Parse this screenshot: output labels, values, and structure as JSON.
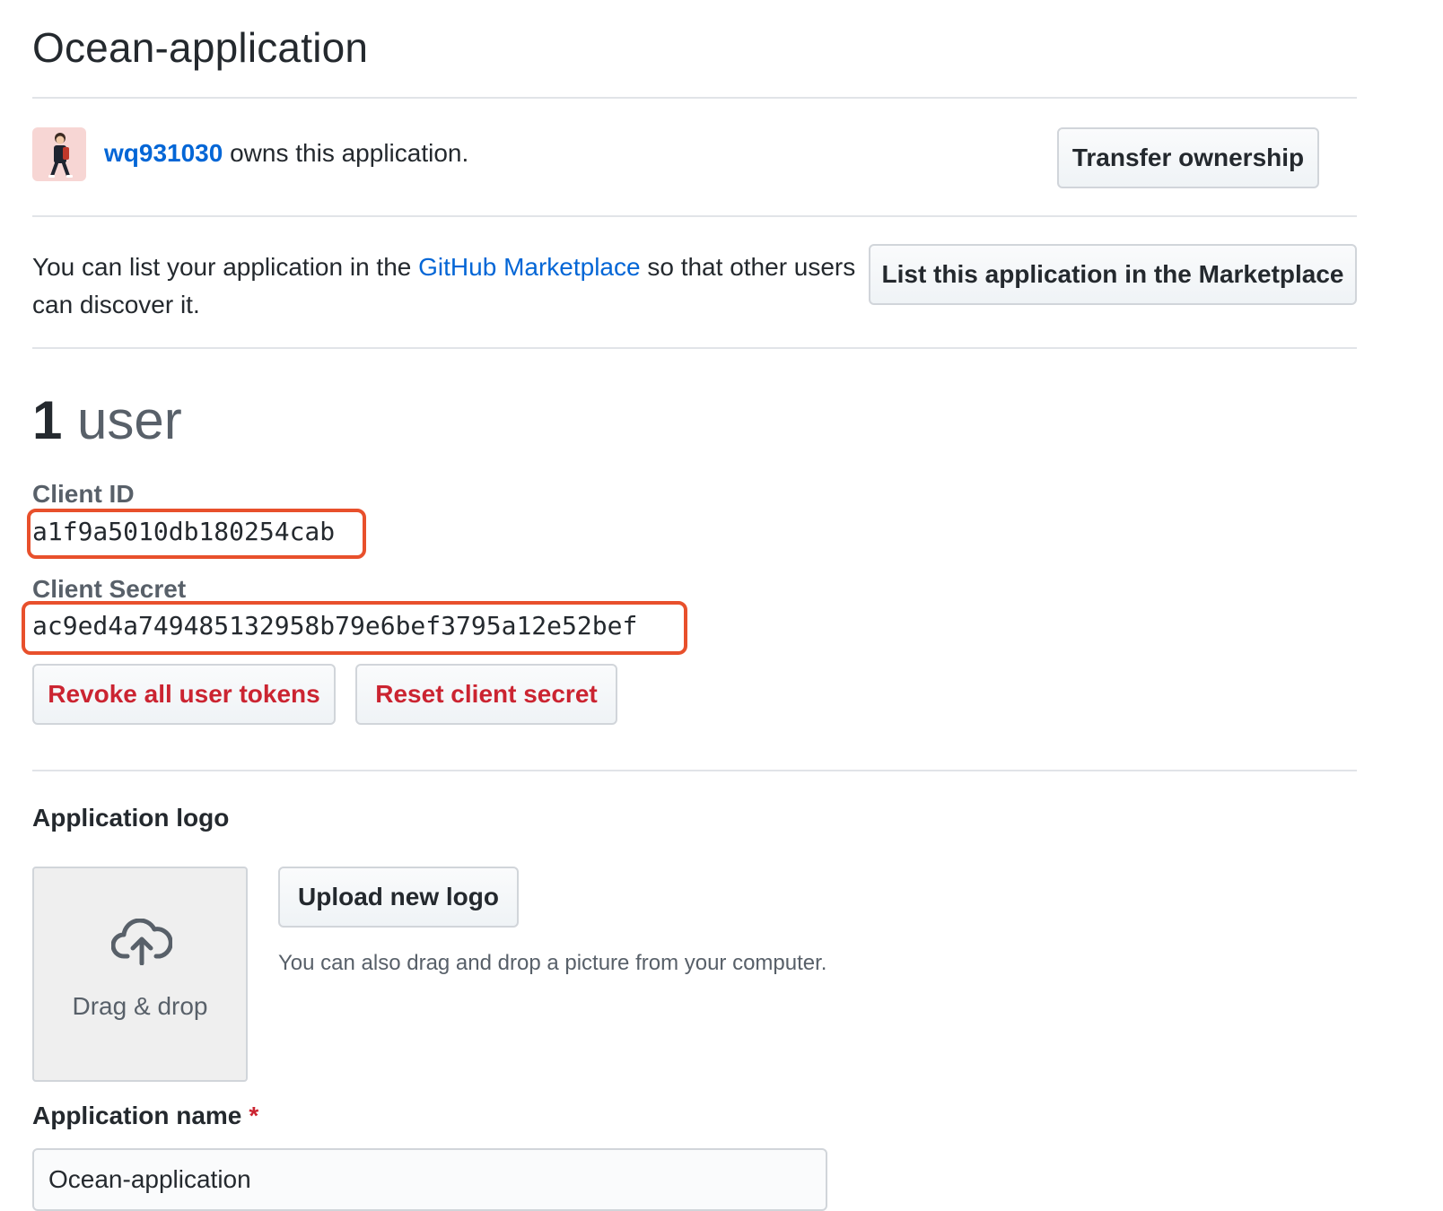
{
  "page": {
    "title": "Ocean-application"
  },
  "owner": {
    "username": "wq931030",
    "suffix": " owns this application.",
    "avatar_icon": "user-avatar-icon",
    "transfer_label": "Transfer ownership"
  },
  "marketplace": {
    "text_before": "You can list your application in the ",
    "link_text": "GitHub Marketplace",
    "text_after": " so that other users can discover it.",
    "button_label": "List this application in the Marketplace"
  },
  "users": {
    "count": "1",
    "label": "user"
  },
  "client_id": {
    "label": "Client ID",
    "value": "a1f9a5010db180254cab"
  },
  "client_secret": {
    "label": "Client Secret",
    "value": "ac9ed4a749485132958b79e6bef3795a12e52bef"
  },
  "actions": {
    "revoke_label": "Revoke all user tokens",
    "reset_label": "Reset client secret"
  },
  "logo": {
    "section_title": "Application logo",
    "dropzone_label": "Drag & drop",
    "dropzone_icon": "cloud-upload-icon",
    "upload_label": "Upload new logo",
    "hint": "You can also drag and drop a picture from your computer."
  },
  "app_name": {
    "label": "Application name",
    "required_mark": "*",
    "value": "Ocean-application"
  },
  "colors": {
    "link": "#0366d6",
    "danger": "#cb2431",
    "highlight": "#e8502c",
    "divider": "#e1e4e8"
  }
}
